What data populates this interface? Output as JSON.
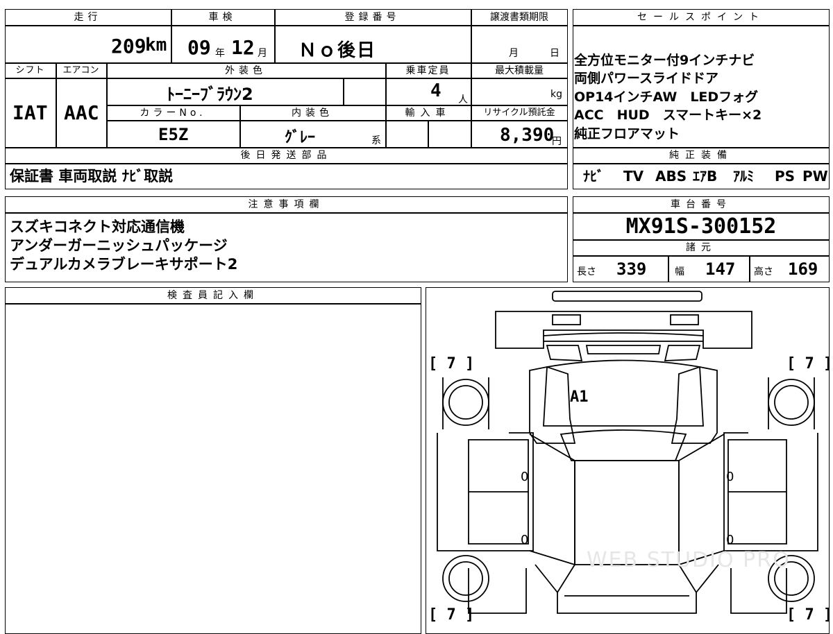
{
  "top_left": {
    "headers": {
      "mileage": "走行",
      "inspection": "車検",
      "registration": "登録番号",
      "transfer_deadline": "譲渡書類期限",
      "shift": "シフト",
      "aircon": "エアコン",
      "exterior_color": "外装色",
      "capacity": "乗車定員",
      "max_load": "最大積載量",
      "color_no": "カラーNo.",
      "interior_color": "内装色",
      "import": "輸入車",
      "recycle_fee": "リサイクル預託金"
    },
    "mileage_value": "209",
    "mileage_unit": "km",
    "inspection_year": "09",
    "year_unit": "年",
    "inspection_month": "12",
    "month_unit": "月",
    "registration_value": "Ｎｏ後日",
    "deadline_month_unit": "月",
    "deadline_day_unit": "日",
    "shift_value": "IAT",
    "aircon_value": "AAC",
    "exterior_color_value": "ﾄｰﾆｰﾌﾞﾗｳﾝ2",
    "capacity_value": "4",
    "capacity_unit": "人",
    "load_unit": "kg",
    "color_no_value": "E5Z",
    "interior_color_value": "ｸﾞﾚｰ",
    "interior_suffix": "系",
    "recycle_value": "8,390",
    "recycle_unit": "円"
  },
  "later_parts": {
    "header": "後日発送部品",
    "value": "保証書 車両取説 ﾅﾋﾞ取説"
  },
  "sales_points": {
    "header": "セールスポイント",
    "lines": [
      "全方位モニター付9インチナビ",
      "両側パワースライドドア",
      "OP14インチAW　LEDフォグ",
      "ACC　HUD　スマートキー×2",
      "純正フロアマット"
    ]
  },
  "genuine_equipment": {
    "header": "純正装備",
    "items": [
      "ﾅﾋﾞ",
      "TV",
      "ABS",
      "ｴｱB",
      "ｱﾙﾐ",
      "PS",
      "PW"
    ]
  },
  "notes": {
    "header": "注意事項欄",
    "lines": [
      "スズキコネクト対応通信機",
      "アンダーガーニッシュパッケージ",
      "デュアルカメラブレーキサポート2"
    ]
  },
  "chassis": {
    "header": "車台番号",
    "value": "MX91S-300152"
  },
  "specs": {
    "header": "諸元",
    "length_label": "長さ",
    "length_value": "339",
    "width_label": "幅",
    "width_value": "147",
    "height_label": "高さ",
    "height_value": "169"
  },
  "inspector": {
    "header": "検査員記入欄"
  },
  "diagram": {
    "tire_fl": "[ 7 ]",
    "tire_fr": "[ 7 ]",
    "tire_rl": "[ 7 ]",
    "tire_rr": "[ 7 ]",
    "mark_a1": "A1",
    "door_lf": "0",
    "door_rf": "0",
    "door_lr": "0",
    "door_rr": "0",
    "watermark": "WEB STUDIO PRO"
  }
}
